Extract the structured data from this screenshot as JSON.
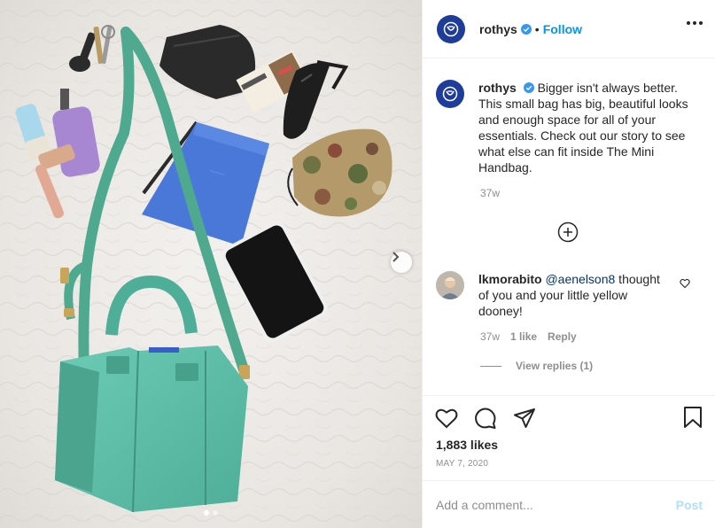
{
  "post": {
    "username": "rothys",
    "separator": "•",
    "follow_label": "Follow",
    "caption_username": "rothys",
    "caption": "Bigger isn't always better. This small bag has big, beautiful looks and enough space for all of your essentials. Check out our story to see what else can fit inside The Mini Handbag.",
    "caption_time": "37w"
  },
  "comment": {
    "username": "lkmorabito",
    "mention": "@aenelson8",
    "text": " thought of you and your little yellow dooney!",
    "time": "37w",
    "likes": "1 like",
    "reply_label": "Reply",
    "view_replies": "View replies (1)"
  },
  "stats": {
    "likes": "1,883 likes",
    "date": "MAY 7, 2020"
  },
  "comment_box": {
    "placeholder": "Add a comment...",
    "post_label": "Post"
  },
  "icons": {
    "avatar": "rothys-logo-icon",
    "verified": "verified-badge-icon",
    "more": "more-options-icon",
    "load_more": "plus-circle-icon",
    "like": "heart-icon",
    "comment": "comment-icon",
    "share": "share-icon",
    "save": "bookmark-icon",
    "next": "chevron-right-icon"
  },
  "colors": {
    "accent": "#0095f6",
    "brand": "#1e3c9a",
    "bag": "#5bbfa7",
    "post_disabled": "#b2dffc"
  },
  "carousel": {
    "slide_count": 2,
    "active_index": 0
  }
}
